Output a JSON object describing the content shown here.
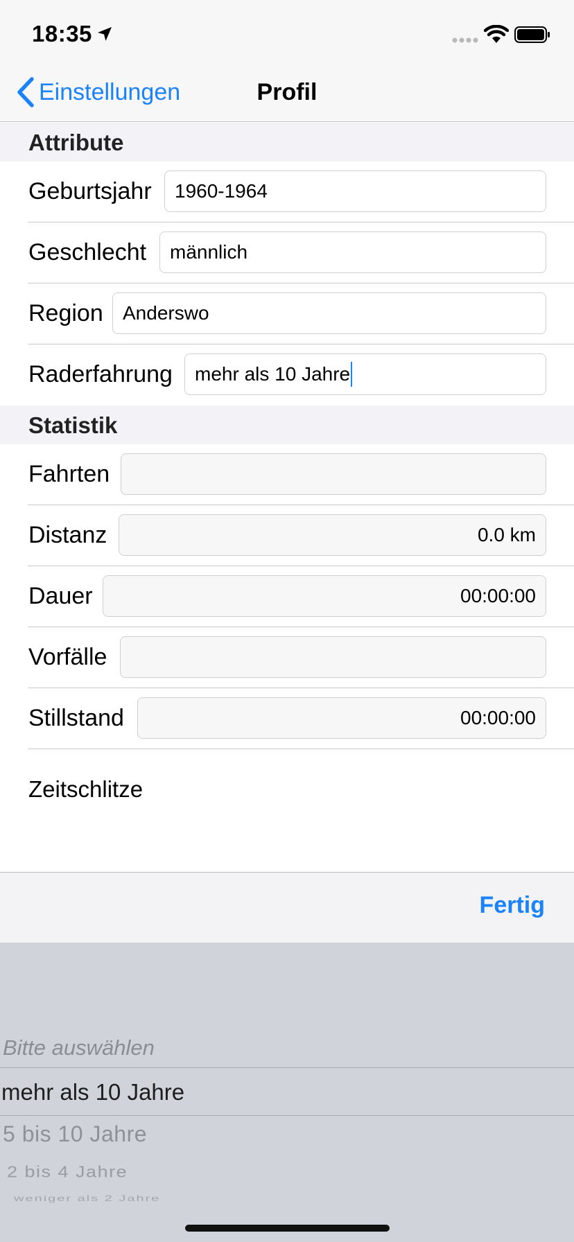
{
  "status_bar": {
    "time": "18:35",
    "icons": [
      "location-arrow-icon",
      "signal-dots-icon",
      "wifi-icon",
      "battery-icon"
    ]
  },
  "nav": {
    "back_label": "Einstellungen",
    "title": "Profil"
  },
  "sections": {
    "attribute": "Attribute",
    "statistik": "Statistik"
  },
  "attribute_rows": [
    {
      "label": "Geburtsjahr",
      "value": "1960-1964"
    },
    {
      "label": "Geschlecht",
      "value": "männlich"
    },
    {
      "label": "Region",
      "value": "Anderswo"
    },
    {
      "label": "Raderfahrung",
      "value": "mehr als 10 Jahre"
    }
  ],
  "statistik_rows": [
    {
      "label": "Fahrten",
      "value": ""
    },
    {
      "label": "Distanz",
      "value": "0.0 km"
    },
    {
      "label": "Dauer",
      "value": "00:00:00"
    },
    {
      "label": "Vorfälle",
      "value": ""
    },
    {
      "label": "Stillstand",
      "value": "00:00:00"
    }
  ],
  "zeitschlitze_label": "Zeitschlitze",
  "toolbar": {
    "done_label": "Fertig"
  },
  "picker": {
    "options": [
      "Bitte auswählen",
      "mehr als 10 Jahre",
      "5 bis 10 Jahre",
      "2 bis 4 Jahre",
      "weniger als 2 Jahre"
    ],
    "selected": "mehr als 10 Jahre"
  },
  "colors": {
    "accent": "#1a82fb",
    "picker_background": "#d1d3da",
    "section_background": "#f2f2f7"
  }
}
